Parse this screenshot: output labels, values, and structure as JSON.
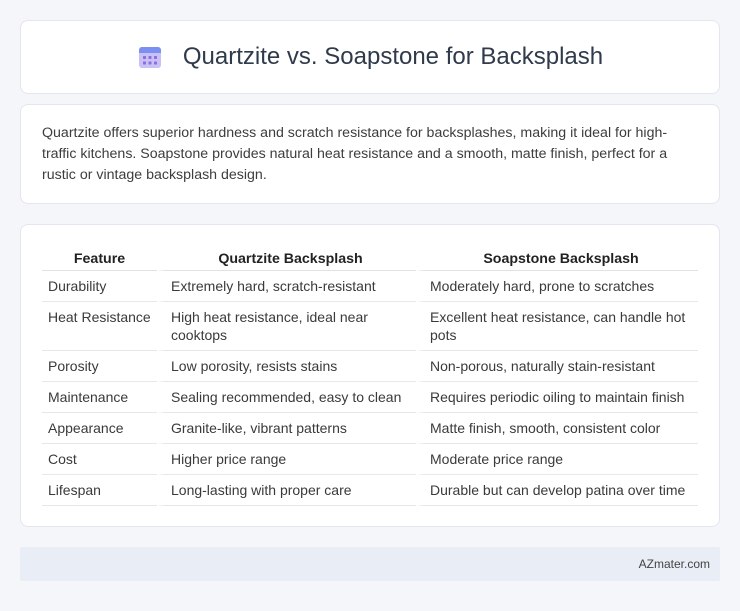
{
  "header": {
    "title": "Quartzite vs. Soapstone for Backsplash",
    "icon": "calendar-icon",
    "icon_color": "#8a7be0"
  },
  "intro": {
    "text": "Quartzite offers superior hardness and scratch resistance for backsplashes, making it ideal for high-traffic kitchens. Soapstone provides natural heat resistance and a smooth, matte finish, perfect for a rustic or vintage backsplash design."
  },
  "table": {
    "headers": [
      "Feature",
      "Quartzite Backsplash",
      "Soapstone Backsplash"
    ],
    "rows": [
      [
        "Durability",
        "Extremely hard, scratch-resistant",
        "Moderately hard, prone to scratches"
      ],
      [
        "Heat Resistance",
        "High heat resistance, ideal near cooktops",
        "Excellent heat resistance, can handle hot pots"
      ],
      [
        "Porosity",
        "Low porosity, resists stains",
        "Non-porous, naturally stain-resistant"
      ],
      [
        "Maintenance",
        "Sealing recommended, easy to clean",
        "Requires periodic oiling to maintain finish"
      ],
      [
        "Appearance",
        "Granite-like, vibrant patterns",
        "Matte finish, smooth, consistent color"
      ],
      [
        "Cost",
        "Higher price range",
        "Moderate price range"
      ],
      [
        "Lifespan",
        "Long-lasting with proper care",
        "Durable but can develop patina over time"
      ]
    ]
  },
  "footer": {
    "brand": "AZmater.com"
  }
}
